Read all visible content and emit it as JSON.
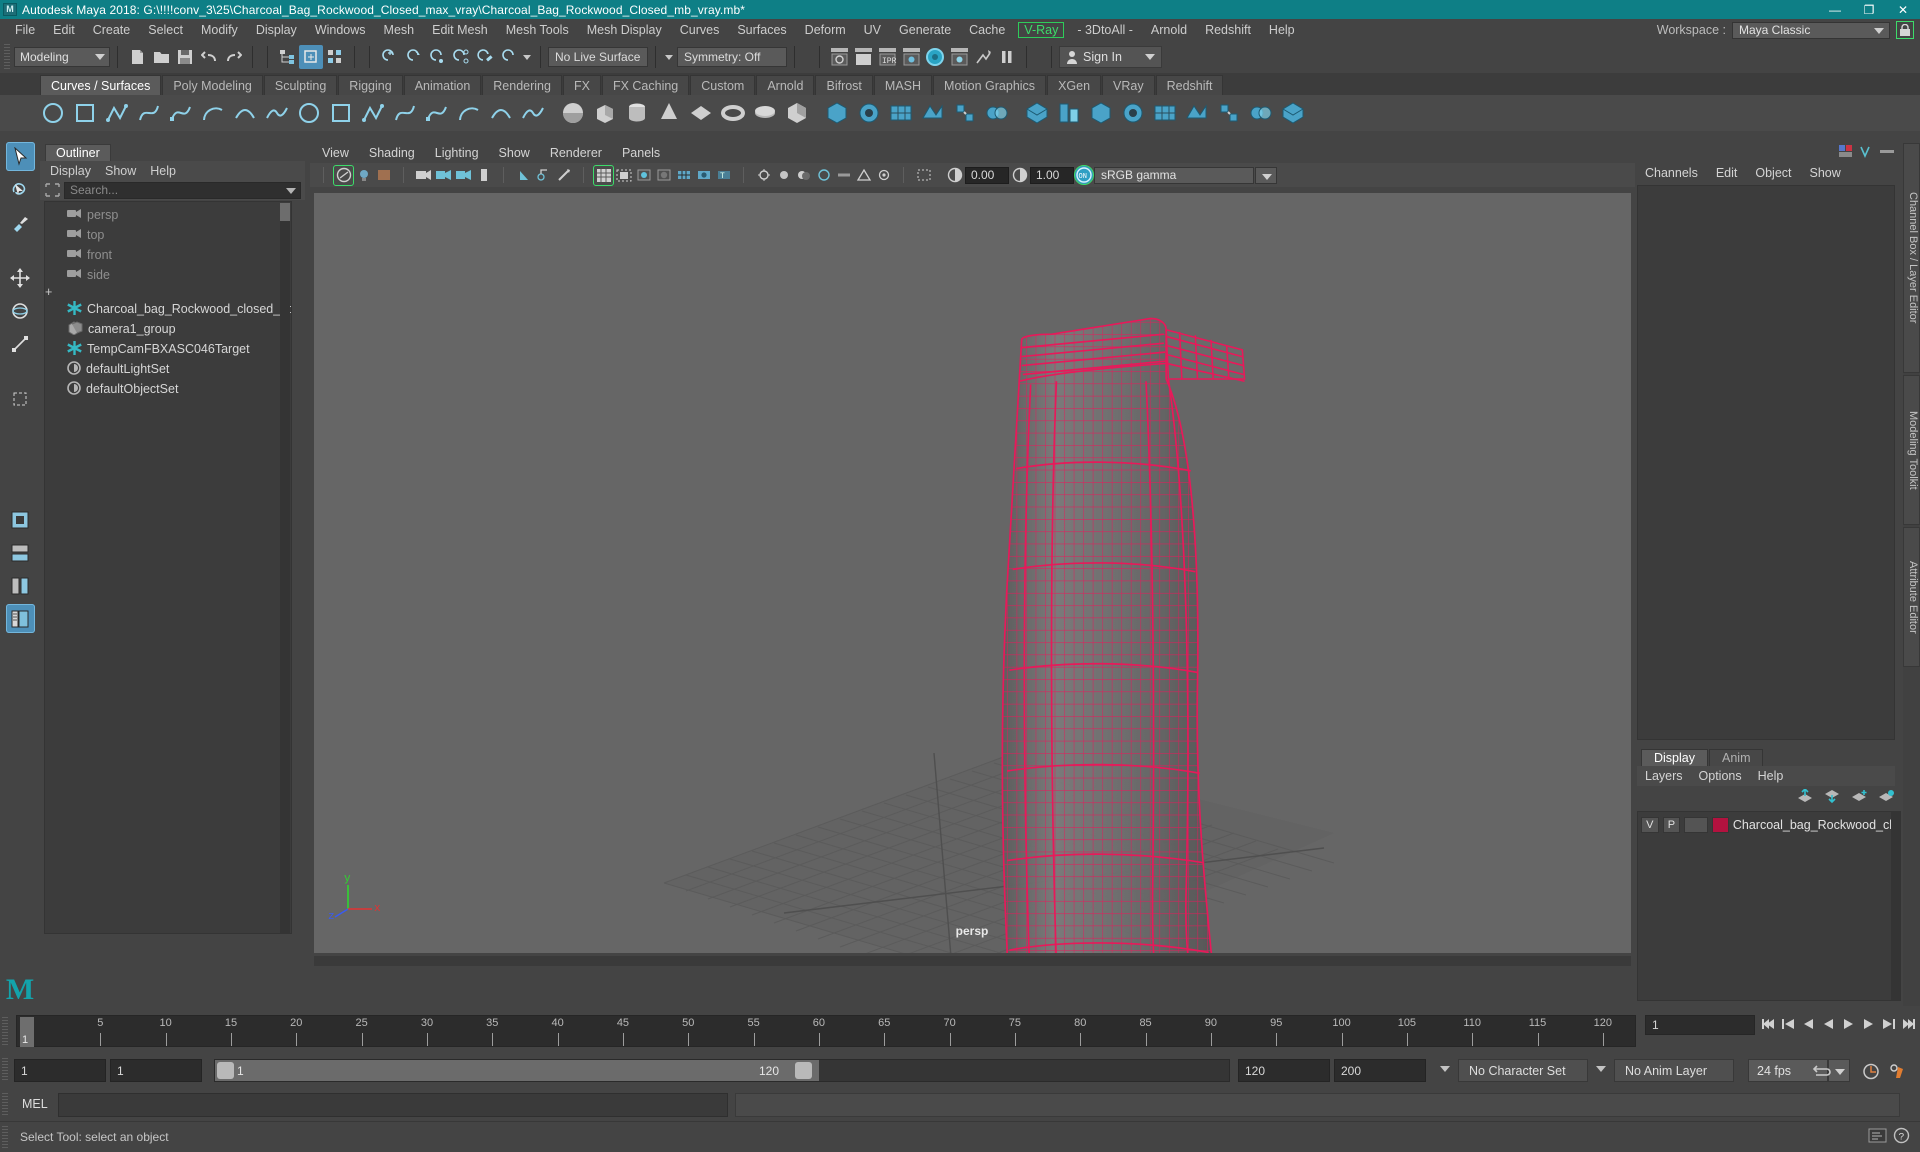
{
  "window": {
    "title": "Autodesk Maya 2018: G:\\!!!!conv_3\\25\\Charcoal_Bag_Rockwood_Closed_max_vray\\Charcoal_Bag_Rockwood_Closed_mb_vray.mb*",
    "logo": "M",
    "minimize": "—",
    "maximize": "❐",
    "close": "✕"
  },
  "menubar": {
    "items": [
      {
        "label": "File"
      },
      {
        "label": "Edit"
      },
      {
        "label": "Create"
      },
      {
        "label": "Select"
      },
      {
        "label": "Modify"
      },
      {
        "label": "Display"
      },
      {
        "label": "Windows"
      },
      {
        "label": "Mesh"
      },
      {
        "label": "Edit Mesh"
      },
      {
        "label": "Mesh Tools"
      },
      {
        "label": "Mesh Display"
      },
      {
        "label": "Curves"
      },
      {
        "label": "Surfaces"
      },
      {
        "label": "Deform"
      },
      {
        "label": "UV"
      },
      {
        "label": "Generate"
      },
      {
        "label": "Cache"
      },
      {
        "label": "V-Ray"
      },
      {
        "label": "- 3DtoAll -"
      },
      {
        "label": "Arnold"
      },
      {
        "label": "Redshift"
      },
      {
        "label": "Help"
      }
    ],
    "workspace_label": "Workspace :",
    "workspace_value": "Maya Classic",
    "lock_icon": "lock-icon"
  },
  "statusbar": {
    "mode": "Modeling",
    "live_surface": "No Live Surface",
    "symmetry": "Symmetry: Off",
    "signin": "Sign In",
    "icons": [
      "new-scene-icon",
      "open-scene-icon",
      "save-scene-icon",
      "undo-icon",
      "redo-icon",
      "select-by-hierarchy-icon",
      "select-by-object-icon",
      "select-by-component-icon",
      "snap-grid-icon",
      "snap-curve-icon",
      "snap-point-icon",
      "snap-projected-icon",
      "snap-view-plane-icon",
      "magnet-icon",
      "snap-normal-icon",
      "render-current-frame-icon",
      "ipr-render-icon",
      "render-settings-icon",
      "hypershade-icon",
      "render-view-icon",
      "render-sequence-icon",
      "pause-icon"
    ]
  },
  "shelf": {
    "tabs": [
      {
        "label": "Curves / Surfaces",
        "active": true
      },
      {
        "label": "Poly Modeling",
        "active": false
      },
      {
        "label": "Sculpting",
        "active": false
      },
      {
        "label": "Rigging",
        "active": false
      },
      {
        "label": "Animation",
        "active": false
      },
      {
        "label": "Rendering",
        "active": false
      },
      {
        "label": "FX",
        "active": false
      },
      {
        "label": "FX Caching",
        "active": false
      },
      {
        "label": "Custom",
        "active": false
      },
      {
        "label": "Arnold",
        "active": false
      },
      {
        "label": "Bifrost",
        "active": false
      },
      {
        "label": "MASH",
        "active": false
      },
      {
        "label": "Motion Graphics",
        "active": false
      },
      {
        "label": "XGen",
        "active": false
      },
      {
        "label": "VRay",
        "active": false
      },
      {
        "label": "Redshift",
        "active": false
      }
    ],
    "items": [
      "nurbs-circle-icon",
      "nurbs-square-icon",
      "ep-curve-icon",
      "pencil-curve-icon",
      "bezier-curve-icon",
      "arc-curve-icon",
      "curve-tool-icon",
      "attach-curve-icon",
      "detach-curve-icon",
      "offset-curve-icon",
      "rebuild-curve-icon",
      "loft-icon",
      "planar-icon",
      "revolve-icon",
      "extrude-icon",
      "birail-icon",
      "nurbs-sphere-icon",
      "nurbs-cube-icon",
      "nurbs-cylinder-icon",
      "nurbs-cone-icon",
      "nurbs-plane-icon",
      "nurbs-torus-icon",
      "nurbs-circle2-icon",
      "nurbs-square2-icon",
      "poly-cube-icon",
      "poly-sphere-icon",
      "poly-cylinder-icon",
      "poly-cone-icon",
      "poly-plane-icon",
      "poly-torus-icon",
      "boolean-union-icon",
      "boolean-diff-icon",
      "boolean-intersect-icon",
      "mirror-icon",
      "combine-icon",
      "separate-icon",
      "bevel-icon",
      "sculpt-icon",
      "smooth-icon"
    ]
  },
  "tools": {
    "items": [
      {
        "name": "select-tool",
        "selected": true
      },
      {
        "name": "lasso-select-tool",
        "selected": false
      },
      {
        "name": "paint-select-tool",
        "selected": false
      },
      {
        "name": "move-tool",
        "selected": false
      },
      {
        "name": "rotate-tool",
        "selected": false
      },
      {
        "name": "scale-tool",
        "selected": false
      },
      {
        "name": "last-tool",
        "selected": false
      },
      {
        "name": "layout-single-pane",
        "selected": false
      },
      {
        "name": "layout-two-pane-stacked",
        "selected": false
      },
      {
        "name": "layout-two-pane-side",
        "selected": false
      },
      {
        "name": "layout-outliner-persp",
        "selected": true
      }
    ],
    "maya_logo": "M"
  },
  "outliner": {
    "tab": "Outliner",
    "menus": [
      "Display",
      "Show",
      "Help"
    ],
    "search_placeholder": "Search...",
    "search_icon": "filter-icon",
    "items": [
      {
        "label": "persp",
        "icon": "camera-icon",
        "dim": true,
        "expandable": false
      },
      {
        "label": "top",
        "icon": "camera-icon",
        "dim": true,
        "expandable": false
      },
      {
        "label": "front",
        "icon": "camera-icon",
        "dim": true,
        "expandable": false
      },
      {
        "label": "side",
        "icon": "camera-icon",
        "dim": true,
        "expandable": false
      },
      {
        "label": "Charcoal_bag_Rockwood_closed_ncl",
        "icon": "transform-icon",
        "dim": false,
        "expandable": true
      },
      {
        "label": "camera1_group",
        "icon": "group-icon",
        "dim": false,
        "expandable": false
      },
      {
        "label": "TempCamFBXASC046Target",
        "icon": "transform-icon",
        "dim": false,
        "expandable": false
      },
      {
        "label": "defaultLightSet",
        "icon": "set-icon",
        "dim": false,
        "expandable": false
      },
      {
        "label": "defaultObjectSet",
        "icon": "set-icon",
        "dim": false,
        "expandable": false
      }
    ]
  },
  "viewport": {
    "menus": [
      "View",
      "Shading",
      "Lighting",
      "Show",
      "Renderer",
      "Panels"
    ],
    "exposure_value": "0.00",
    "gamma_value": "1.00",
    "color_management": "sRGB gamma",
    "camera_label": "persp",
    "gizmo": {
      "x": "x",
      "y": "y",
      "z": "z",
      "x_color": "#e33232",
      "y_color": "#2fd52f",
      "z_color": "#3a5bf0"
    },
    "wireframe_color": "#e8195a",
    "background_color": "#666666",
    "icons": [
      "select-camera-icon",
      "lights-icon",
      "textures-icon",
      "camera-attrs-icon",
      "bookmarks-icon",
      "image-plane-icon",
      "grid-icon",
      "film-gate-icon",
      "resolution-gate-icon",
      "gate-mask-icon",
      "xray-icon",
      "xray-joints-icon",
      "smooth-shade-icon",
      "wireframe-on-shaded-icon",
      "hardware-texturing-icon",
      "use-default-light-icon",
      "shadows-icon",
      "motion-blur-icon",
      "ambient-occlusion-icon",
      "anti-alias-icon",
      "depth-of-field-icon",
      "isolate-select-icon",
      "exposure-icon",
      "gamma-icon"
    ]
  },
  "channelbox": {
    "menus": [
      "Channels",
      "Edit",
      "Object",
      "Show"
    ],
    "header_icons": [
      "channelbox-icon",
      "attribute-editor-icon",
      "tool-settings-icon"
    ]
  },
  "layereditor": {
    "tabs": [
      {
        "label": "Display",
        "active": true
      },
      {
        "label": "Anim",
        "active": false
      }
    ],
    "menus": [
      "Layers",
      "Options",
      "Help"
    ],
    "buttons": [
      "move-layer-up-icon",
      "move-layer-down-icon",
      "new-layer-icon",
      "new-layer-from-selected-icon"
    ],
    "layers": [
      {
        "visibility": "V",
        "playback": "P",
        "type": "",
        "color": "#b3123f",
        "name": "Charcoal_bag_Rockwood_clos"
      }
    ]
  },
  "vertical_tabs": [
    {
      "label": "Channel Box / Layer Editor"
    },
    {
      "label": "Modeling Toolkit"
    },
    {
      "label": "Attribute Editor"
    }
  ],
  "timeslider": {
    "current_frame": "1",
    "ticks": [
      5,
      10,
      15,
      20,
      25,
      30,
      35,
      40,
      45,
      50,
      55,
      60,
      65,
      70,
      75,
      80,
      85,
      90,
      95,
      100,
      105,
      110,
      115,
      120
    ],
    "end_field": "1",
    "playback_icons": [
      "go-to-start-icon",
      "step-back-key-icon",
      "step-back-frame-icon",
      "play-backwards-icon",
      "play-forwards-icon",
      "step-forward-frame-icon",
      "step-forward-key-icon",
      "go-to-end-icon"
    ]
  },
  "rangeslider": {
    "start_field": "1",
    "range_start_field": "1",
    "range_start_label": "1",
    "range_end_label": "120",
    "range_end_field": "120",
    "playback_end_field": "200",
    "character_set": "No Character Set",
    "anim_layer": "No Anim Layer",
    "fps": "24 fps",
    "icons": [
      "auto-key-icon",
      "anim-preferences-icon",
      "loop-icon"
    ]
  },
  "commandline": {
    "label": "MEL",
    "input_value": "",
    "output_value": ""
  },
  "statusline": {
    "message": "Select Tool: select an object",
    "icons": [
      "script-editor-icon",
      "help-icon"
    ]
  }
}
